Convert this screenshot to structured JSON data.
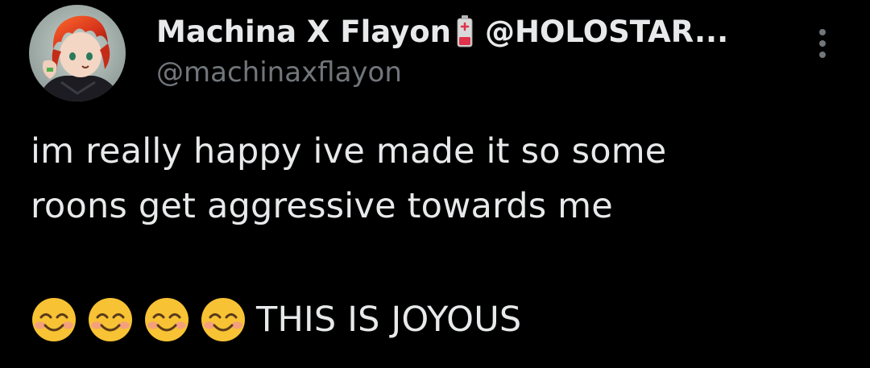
{
  "tweet": {
    "author": {
      "display_name": "Machina X Flayon",
      "name_suffix": "@HOLOSTAR...",
      "username": "@machinaxflayon",
      "badge_icon": "battery-low-icon",
      "avatar_icon": "avatar"
    },
    "body": {
      "line1": "im really happy ive made it so some",
      "line2": "roons get aggressive towards me",
      "emojis": [
        "smiling-face-with-smiling-eyes",
        "smiling-face-with-smiling-eyes",
        "smiling-face-with-smiling-eyes",
        "smiling-face-with-smiling-eyes"
      ],
      "line3_text": "THIS IS JOYOUS"
    },
    "more_icon": "more-vertical-icon"
  },
  "colors": {
    "background": "#000000",
    "text_primary": "#e7e9ea",
    "text_secondary": "#71767b",
    "battery_red": "#e0324a",
    "emoji_yellow": "#f7c234"
  }
}
